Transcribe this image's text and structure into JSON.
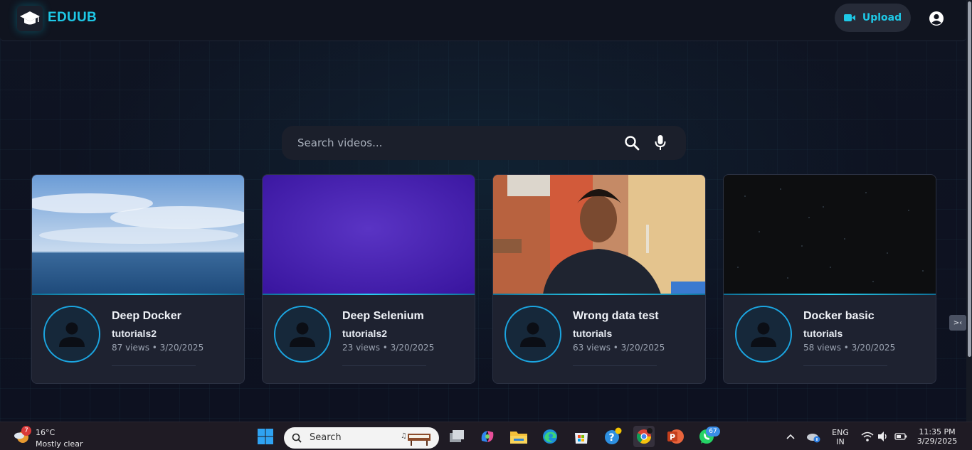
{
  "header": {
    "logo_text": "EDUUB",
    "upload_label": "Upload"
  },
  "search": {
    "placeholder": "Search videos..."
  },
  "videos": [
    {
      "title": "Deep Docker",
      "channel": "tutorials2",
      "meta": "87 views • 3/20/2025",
      "thumbnail": "ocean-sky"
    },
    {
      "title": "Deep Selenium",
      "channel": "tutorials2",
      "meta": "23 views • 3/20/2025",
      "thumbnail": "purple-gradient"
    },
    {
      "title": "Wrong data test",
      "channel": "tutorials",
      "meta": "63 views • 3/20/2025",
      "thumbnail": "person-webcam"
    },
    {
      "title": "Docker basic",
      "channel": "tutorials",
      "meta": "58 views • 3/20/2025",
      "thumbnail": "dark-starfield"
    }
  ],
  "side_toggle_label": ">‹",
  "colors": {
    "accent": "#1ec8e6",
    "background": "#0e1220",
    "card": "#1e2230",
    "avatar_ring": "#1ba5e0"
  },
  "taskbar": {
    "weather_temp": "16°C",
    "weather_desc": "Mostly clear",
    "weather_badge": "7",
    "search_label": "Search",
    "whatsapp_badge": "67",
    "language_line1": "ENG",
    "language_line2": "IN",
    "time": "11:35 PM",
    "date": "3/29/2025"
  }
}
